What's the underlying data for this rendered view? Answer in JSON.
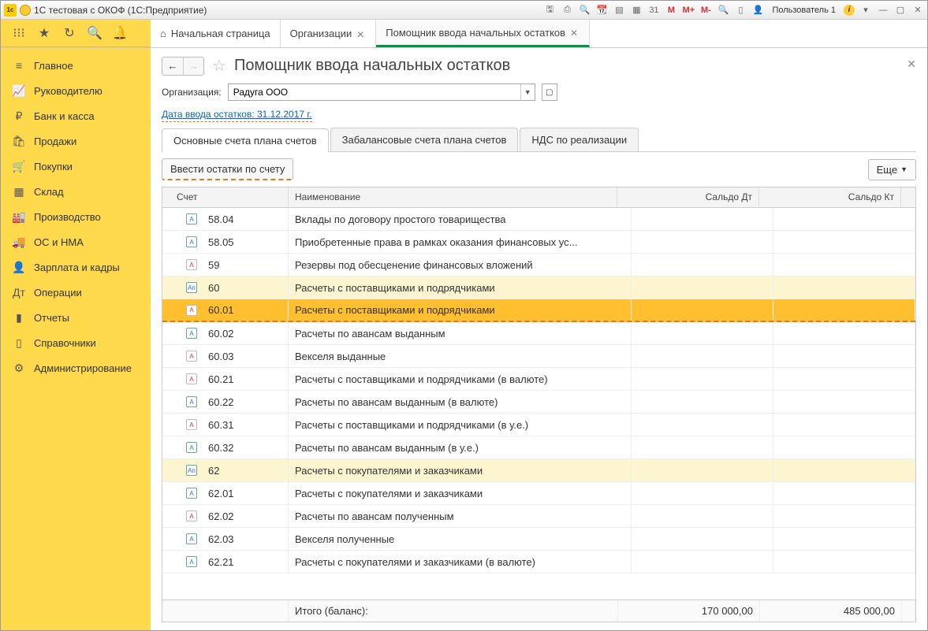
{
  "window": {
    "title": "1С тестовая с ОКОФ  (1С:Предприятие)",
    "user": "Пользователь 1"
  },
  "tabs": [
    {
      "label": "Начальная страница",
      "closable": false,
      "home": true
    },
    {
      "label": "Организации",
      "closable": true
    },
    {
      "label": "Помощник ввода начальных остатков",
      "closable": true,
      "active": true
    }
  ],
  "sidebar": [
    {
      "icon": "≡",
      "label": "Главное"
    },
    {
      "icon": "📈",
      "label": "Руководителю"
    },
    {
      "icon": "₽",
      "label": "Банк и касса"
    },
    {
      "icon": "🛍",
      "label": "Продажи"
    },
    {
      "icon": "🛒",
      "label": "Покупки"
    },
    {
      "icon": "▦",
      "label": "Склад"
    },
    {
      "icon": "🏭",
      "label": "Производство"
    },
    {
      "icon": "🚚",
      "label": "ОС и НМА"
    },
    {
      "icon": "👤",
      "label": "Зарплата и кадры"
    },
    {
      "icon": "Дт",
      "label": "Операции"
    },
    {
      "icon": "▮",
      "label": "Отчеты"
    },
    {
      "icon": "▯",
      "label": "Справочники"
    },
    {
      "icon": "⚙",
      "label": "Администрирование"
    }
  ],
  "page": {
    "title": "Помощник ввода начальных остатков",
    "org_label": "Организация:",
    "org_value": "Радуга ООО",
    "date_link": "Дата ввода остатков: 31.12.2017 г."
  },
  "inner_tabs": [
    {
      "label": "Основные счета плана счетов",
      "active": true
    },
    {
      "label": "Забалансовые счета плана счетов"
    },
    {
      "label": "НДС по реализации"
    }
  ],
  "actions": {
    "enter_balance": "Ввести остатки по счету",
    "more": "Еще"
  },
  "columns": {
    "account": "Счет",
    "name": "Наименование",
    "debit": "Сальдо Дт",
    "credit": "Сальдо Кт"
  },
  "rows": [
    {
      "code": "58.04",
      "name": "Вклады по договору простого товарищества",
      "iconColor": "blue"
    },
    {
      "code": "58.05",
      "name": "Приобретенные права в рамках оказания финансовых ус...",
      "iconColor": "blue"
    },
    {
      "code": "59",
      "name": "Резервы под обесценение финансовых вложений",
      "iconColor": "red"
    },
    {
      "code": "60",
      "name": "Расчеты с поставщиками и подрядчиками",
      "iconColor": "blue",
      "softHighlight": true,
      "group": true
    },
    {
      "code": "60.01",
      "name": "Расчеты с поставщиками и подрядчиками",
      "iconColor": "red",
      "selected": true
    },
    {
      "code": "60.02",
      "name": "Расчеты по авансам выданным",
      "iconColor": "blue"
    },
    {
      "code": "60.03",
      "name": "Векселя выданные",
      "iconColor": "red"
    },
    {
      "code": "60.21",
      "name": "Расчеты с поставщиками и подрядчиками (в валюте)",
      "iconColor": "red"
    },
    {
      "code": "60.22",
      "name": "Расчеты по авансам выданным (в валюте)",
      "iconColor": "blue"
    },
    {
      "code": "60.31",
      "name": "Расчеты с поставщиками и подрядчиками (в у.е.)",
      "iconColor": "red"
    },
    {
      "code": "60.32",
      "name": "Расчеты по авансам выданным (в у.е.)",
      "iconColor": "blue"
    },
    {
      "code": "62",
      "name": "Расчеты с покупателями и заказчиками",
      "iconColor": "blue",
      "softHighlight": true,
      "group": true
    },
    {
      "code": "62.01",
      "name": "Расчеты с покупателями и заказчиками",
      "iconColor": "blue"
    },
    {
      "code": "62.02",
      "name": "Расчеты по авансам полученным",
      "iconColor": "red"
    },
    {
      "code": "62.03",
      "name": "Векселя полученные",
      "iconColor": "blue"
    },
    {
      "code": "62.21",
      "name": "Расчеты с покупателями и заказчиками (в валюте)",
      "iconColor": "blue"
    }
  ],
  "footer": {
    "label": "Итого (баланс):",
    "debit": "170 000,00",
    "credit": "485 000,00"
  }
}
